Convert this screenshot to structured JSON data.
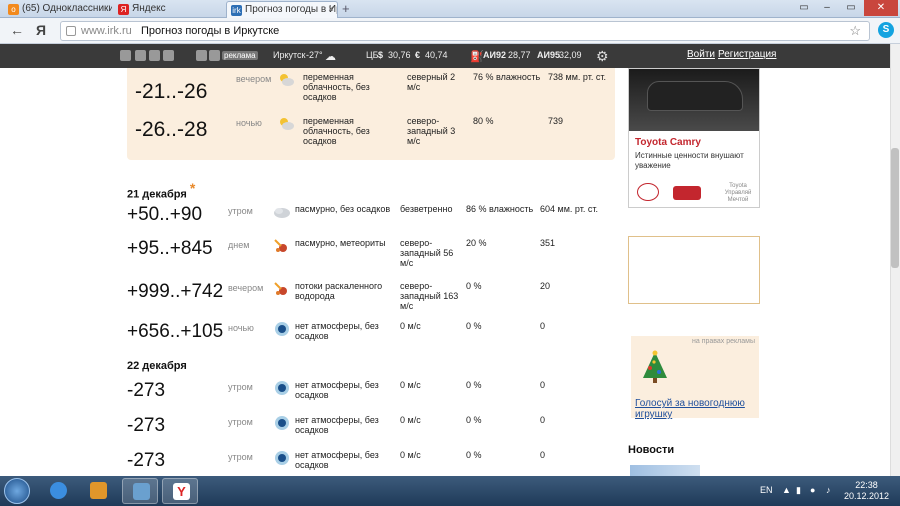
{
  "browser": {
    "tabs": [
      {
        "label": "(65) Одноклассники",
        "favicon": "ok-icon",
        "active": false
      },
      {
        "label": "Яндекс",
        "favicon": "yandex-icon",
        "active": false
      },
      {
        "label": "Прогноз погоды в Ирк",
        "favicon": "irk-icon",
        "active": true
      }
    ],
    "new_tab": "+",
    "address": {
      "host": "www.irk.ru",
      "separator": " ",
      "title": "Прогноз погоды в Иркутске"
    },
    "yandex_button": "Я"
  },
  "sitebar": {
    "ad_badge": "реклама",
    "city": "Иркутск",
    "temp": "-27°",
    "cb_label": "ЦБ",
    "usd": "30,76",
    "eur": "40,74",
    "fuel1_label": "АИ92",
    "fuel1_price": "28,77",
    "fuel2_label": "АИ95",
    "fuel2_price": "32,09",
    "login": "Войти",
    "register": "Регистрация"
  },
  "forecast": {
    "top_rows": [
      {
        "temp": "-21..-26",
        "period": "вечером",
        "icon": "cloudy-sun-icon",
        "desc": "переменная облачность, без осадков",
        "wind": "северный 2 м/с",
        "humidity": "76 % влажность",
        "pressure": "738 мм. рт. ст."
      },
      {
        "temp": "-26..-28",
        "period": "ночью",
        "icon": "cloudy-sun-icon",
        "desc": "переменная облачность, без осадков",
        "wind": "северо-западный 3 м/с",
        "humidity": "80 %",
        "pressure": "739"
      }
    ],
    "day21": {
      "title": "21 декабря",
      "asterisk": "*",
      "rows": [
        {
          "temp": "+50..+90",
          "period": "утром",
          "icon": "overcast-icon",
          "desc": "пасмурно, без осадков",
          "wind": "безветренно",
          "humidity": "86 % влажность",
          "pressure": "604 мм. рт. ст."
        },
        {
          "temp": "+95..+845",
          "period": "днем",
          "icon": "meteor-icon",
          "desc": "пасмурно, метеориты",
          "wind": "северо-западный 56 м/с",
          "humidity": "20 %",
          "pressure": "351"
        },
        {
          "temp": "+999..+742",
          "period": "вечером",
          "icon": "meteor-icon",
          "desc": "потоки раскаленного водорода",
          "wind": "северо-западный 163 м/с",
          "humidity": "0 %",
          "pressure": "20"
        },
        {
          "temp": "+656..+105",
          "period": "ночью",
          "icon": "void-icon",
          "desc": "нет атмосферы, без осадков",
          "wind": "0 м/с",
          "humidity": "0 %",
          "pressure": "0"
        }
      ]
    },
    "day22": {
      "title": "22 декабря",
      "rows": [
        {
          "temp": "-273",
          "period": "утром",
          "icon": "void-icon",
          "desc": "нет атмосферы, без осадков",
          "wind": "0 м/с",
          "humidity": "0 %",
          "pressure": "0"
        },
        {
          "temp": "-273",
          "period": "утром",
          "icon": "void-icon",
          "desc": "нет атмосферы, без осадков",
          "wind": "0 м/с",
          "humidity": "0 %",
          "pressure": "0"
        },
        {
          "temp": "-273",
          "period": "утром",
          "icon": "void-icon",
          "desc": "нет атмосферы, без осадков",
          "wind": "0 м/с",
          "humidity": "0 %",
          "pressure": "0"
        }
      ]
    }
  },
  "sidebar": {
    "ad_title": "Toyota Camry",
    "ad_text": "Истинные ценности внушают уважение",
    "ad_small": "Toyota Управляй Мечтой",
    "vote_label": "на правах рекламы",
    "vote_link": "Голосуй за новогоднюю игрушку",
    "news_title": "Новости"
  },
  "taskbar": {
    "lang": "EN",
    "time": "22:38",
    "date": "20.12.2012"
  },
  "colors": {
    "accent": "#e8892a",
    "beige": "#fbeede",
    "link": "#1f4f9c"
  }
}
